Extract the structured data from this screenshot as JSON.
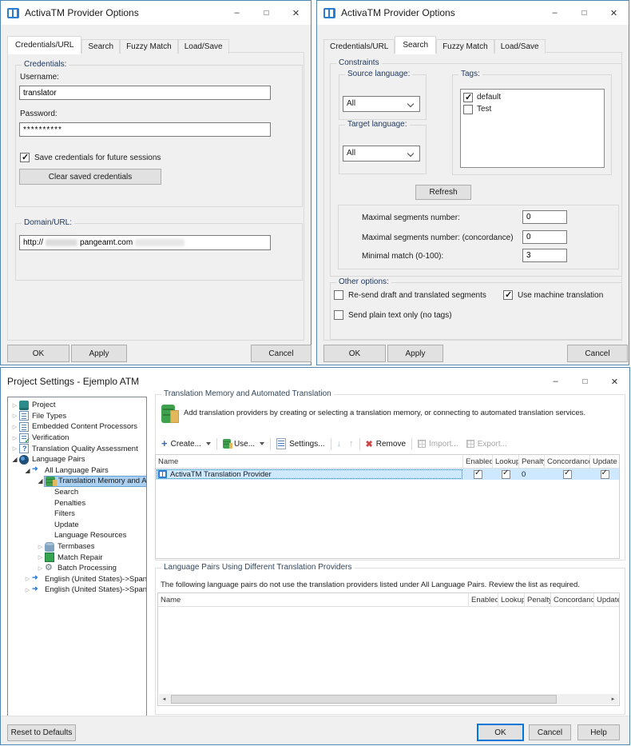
{
  "colors": {
    "window_border": "#5286b4",
    "titlebar_bg": "#ffffff",
    "dialog_bg": "#f0f0f0",
    "accent_blue": "#2b7cd3",
    "row_selection": "#cde8ff",
    "tree_selection": "#abcfef",
    "remove_red": "#d04545",
    "tm_green": "#3fa14d",
    "tm_yellow": "#e3b85c"
  },
  "icons": {
    "minimize_glyph": "–",
    "maximize_glyph": "□",
    "close_glyph": "✕",
    "create_plus_glyph": "+",
    "move_down_glyph": "↓",
    "move_up_glyph": "↑",
    "remove_x_glyph": "✖",
    "scroll_left_glyph": "◄",
    "scroll_right_glyph": "►"
  },
  "dialog1": {
    "title": "ActivaTM Provider Options",
    "tabs": {
      "credentials": "Credentials/URL",
      "search": "Search",
      "fuzzy": "Fuzzy Match",
      "load": "Load/Save"
    },
    "credentials": {
      "group_label": "Credentials:",
      "username_label": "Username:",
      "username_value": "translator",
      "password_label": "Password:",
      "password_value": "**********",
      "save_checkbox_label": "Save credentials for future sessions",
      "save_checkbox_checked": true,
      "clear_button_label": "Clear saved credentials"
    },
    "domain": {
      "group_label": "Domain/URL:",
      "url_prefix": "http://",
      "url_host": "pangeamt.com"
    },
    "ok": "OK",
    "apply": "Apply",
    "cancel": "Cancel"
  },
  "dialog2": {
    "title": "ActivaTM Provider Options",
    "tabs": {
      "credentials": "Credentials/URL",
      "search": "Search",
      "fuzzy": "Fuzzy Match",
      "load": "Load/Save"
    },
    "constraints_label": "Constraints",
    "source_language": {
      "label": "Source language:",
      "value": "All"
    },
    "target_language": {
      "label": "Target language:",
      "value": "All"
    },
    "tags": {
      "label": "Tags:",
      "item1": {
        "label": "default",
        "checked": true
      },
      "item2": {
        "label": "Test",
        "checked": false
      }
    },
    "refresh_button": "Refresh",
    "limits": {
      "row1": {
        "label": "Maximal segments number:",
        "value": "0"
      },
      "row2": {
        "label": "Maximal segments number: (concordance)",
        "value": "0"
      },
      "row3": {
        "label": "Minimal match (0-100):",
        "value": "3"
      }
    },
    "other_options": {
      "label": "Other options:",
      "cb1": {
        "label": "Re-send draft and translated segments",
        "checked": false
      },
      "cb2": {
        "label": "Use machine translation",
        "checked": true
      },
      "cb3": {
        "label": "Send plain text only (no tags)",
        "checked": false
      }
    },
    "ok": "OK",
    "apply": "Apply",
    "cancel": "Cancel"
  },
  "project": {
    "title": "Project Settings - Ejemplo ATM",
    "tree": [
      {
        "label": "Project"
      },
      {
        "label": "File Types"
      },
      {
        "label": "Embedded Content Processors"
      },
      {
        "label": "Verification"
      },
      {
        "label": "Translation Quality Assessment"
      },
      {
        "label": "Language Pairs"
      },
      {
        "label": "All Language Pairs"
      },
      {
        "label": "Translation Memory and Auto"
      },
      {
        "label": "Search"
      },
      {
        "label": "Penalties"
      },
      {
        "label": "Filters"
      },
      {
        "label": "Update"
      },
      {
        "label": "Language Resources"
      },
      {
        "label": "Termbases"
      },
      {
        "label": "Match Repair"
      },
      {
        "label": "Batch Processing"
      },
      {
        "label": "English (United States)->Spanish"
      },
      {
        "label": "English (United States)->Spanish"
      }
    ],
    "tm_section": {
      "group_label": "Translation Memory and Automated Translation",
      "description": "Add translation providers by creating or selecting a translation memory, or connecting to automated translation services.",
      "toolbar": {
        "create": "Create...",
        "use": "Use...",
        "settings": "Settings...",
        "remove": "Remove",
        "import": "Import...",
        "export": "Export..."
      },
      "columns": {
        "name": "Name",
        "enabled": "Enabled",
        "lookup": "Lookup",
        "penalty": "Penalty",
        "concordance": "Concordance",
        "update": "Update"
      },
      "row": {
        "name": "ActivaTM Translation Provider",
        "enabled": true,
        "lookup": true,
        "penalty": "0",
        "concordance": true,
        "update": true
      }
    },
    "lp_section": {
      "group_label": "Language Pairs Using Different Translation Providers",
      "description": "The following language pairs do not use the translation providers listed under All Language Pairs. Review the list as required.",
      "columns": {
        "name": "Name",
        "enabled": "Enabled",
        "lookup": "Lookup",
        "penalty": "Penalty",
        "concordance": "Concordance",
        "update": "Update"
      }
    },
    "reset_button": "Reset to Defaults",
    "ok": "OK",
    "cancel": "Cancel",
    "help": "Help"
  }
}
